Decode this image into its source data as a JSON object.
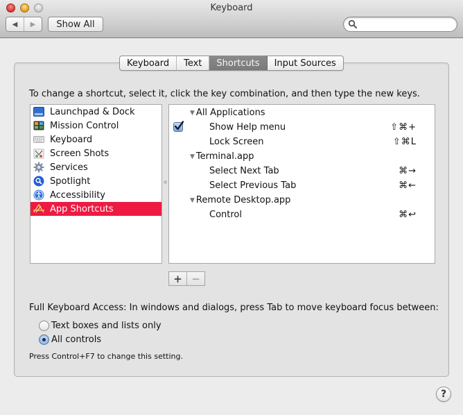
{
  "window": {
    "title": "Keyboard"
  },
  "toolbar": {
    "back_icon": "◀",
    "forward_icon": "▶",
    "show_all_label": "Show All",
    "search_value": "",
    "search_placeholder": ""
  },
  "tabs": [
    {
      "label": "Keyboard",
      "active": false
    },
    {
      "label": "Text",
      "active": false
    },
    {
      "label": "Shortcuts",
      "active": true
    },
    {
      "label": "Input Sources",
      "active": false
    }
  ],
  "instructions": "To change a shortcut, select it, click the key combination, and then type the new keys.",
  "categories": [
    {
      "label": "Launchpad & Dock",
      "icon": "launchpad-dock-icon",
      "selected": false
    },
    {
      "label": "Mission Control",
      "icon": "mission-control-icon",
      "selected": false
    },
    {
      "label": "Keyboard",
      "icon": "keyboard-icon",
      "selected": false
    },
    {
      "label": "Screen Shots",
      "icon": "screenshot-icon",
      "selected": false
    },
    {
      "label": "Services",
      "icon": "gear-icon",
      "selected": false
    },
    {
      "label": "Spotlight",
      "icon": "spotlight-icon",
      "selected": false
    },
    {
      "label": "Accessibility",
      "icon": "accessibility-icon",
      "selected": false
    },
    {
      "label": "App Shortcuts",
      "icon": "app-store-icon",
      "selected": true
    }
  ],
  "shortcuts": [
    {
      "type": "group",
      "label": "All Applications",
      "triangle": "▼"
    },
    {
      "type": "item",
      "label": "Show Help menu",
      "checked": true,
      "key": "⇧⌘+"
    },
    {
      "type": "item",
      "label": "Lock Screen",
      "checked": false,
      "key": "⇧⌘L"
    },
    {
      "type": "group",
      "label": "Terminal.app",
      "triangle": "▼"
    },
    {
      "type": "item",
      "label": "Select Next Tab",
      "checked": false,
      "key": "⌘→"
    },
    {
      "type": "item",
      "label": "Select Previous Tab",
      "checked": false,
      "key": "⌘←"
    },
    {
      "type": "group",
      "label": "Remote Desktop.app",
      "triangle": "▼"
    },
    {
      "type": "item",
      "label": "Control",
      "checked": false,
      "key": "⌘↩"
    }
  ],
  "buttons": {
    "add_label": "+",
    "remove_label": "−"
  },
  "full_keyboard_access": {
    "label": "Full Keyboard Access: In windows and dialogs, press Tab to move keyboard focus between:",
    "options": [
      {
        "label": "Text boxes and lists only",
        "selected": false
      },
      {
        "label": "All controls",
        "selected": true
      }
    ],
    "hint": "Press Control+F7 to change this setting."
  },
  "help_label": "?",
  "colors": {
    "selection": "#ee1a42",
    "active_tab": "#808080"
  }
}
